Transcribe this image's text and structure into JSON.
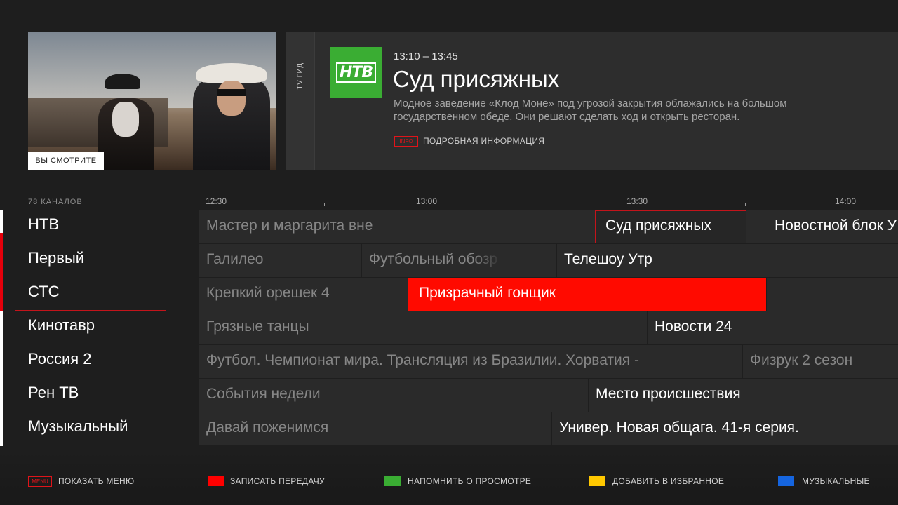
{
  "now_watching": {
    "label": "ВЫ СМОТРИТЕ"
  },
  "info_panel": {
    "tab_label": "TV-ГИД",
    "channel_logo_text": "НТВ",
    "time_range": "13:10 – 13:45",
    "title": "Суд присяжных",
    "description": "Модное заведение «Клод Моне» под угрозой закрытия облажались на большом государственном обеде. Они решают сделать ход и открыть ресторан.",
    "info_badge": "INFO",
    "details_link": "ПОДРОБНАЯ ИНФОРМАЦИЯ",
    "logo_color": "#3aad33"
  },
  "guide": {
    "channels_count": "78 КАНАЛОВ",
    "time_labels": [
      "12:30",
      "13:00",
      "13:30",
      "14:00"
    ],
    "channels": [
      "НТВ",
      "Первый",
      "СТС",
      "Кинотавр",
      "Россия 2",
      "Рен ТВ",
      "Музыкальный"
    ],
    "selected_channel": "СТС",
    "rows": [
      [
        "Мастер и маргарита вне",
        "Суд присяжных",
        "Новостной блок У"
      ],
      [
        "Галилео",
        "Футбольный обозр",
        "Телешоу Утр"
      ],
      [
        "Крепкий орешек 4",
        "Призрачный гонщик",
        ""
      ],
      [
        "Грязные танцы",
        "Новости 24"
      ],
      [
        "Футбол. Чемпионат мира. Трансляция из Бразилии. Хорватия -",
        "Физрук 2 сезон"
      ],
      [
        "События недели",
        "Место происшествия"
      ],
      [
        "Давай поженимся",
        "Универ. Новая общага. 41-я серия."
      ]
    ],
    "accent_color": "#ff0a00"
  },
  "bottom_bar": {
    "menu_badge": "MENU",
    "menu_label": "ПОКАЗАТЬ МЕНЮ",
    "record_label": "ЗАПИСАТЬ ПЕРЕДАЧУ",
    "remind_label": "НАПОМНИТЬ О ПРОСМОТРЕ",
    "favorite_label": "ДОБАВИТЬ В ИЗБРАННОЕ",
    "music_label": "МУЗЫКАЛЬНЫЕ",
    "colors": {
      "red": "#ff0000",
      "green": "#3aad33",
      "yellow": "#ffc800",
      "blue": "#1565e0"
    }
  }
}
